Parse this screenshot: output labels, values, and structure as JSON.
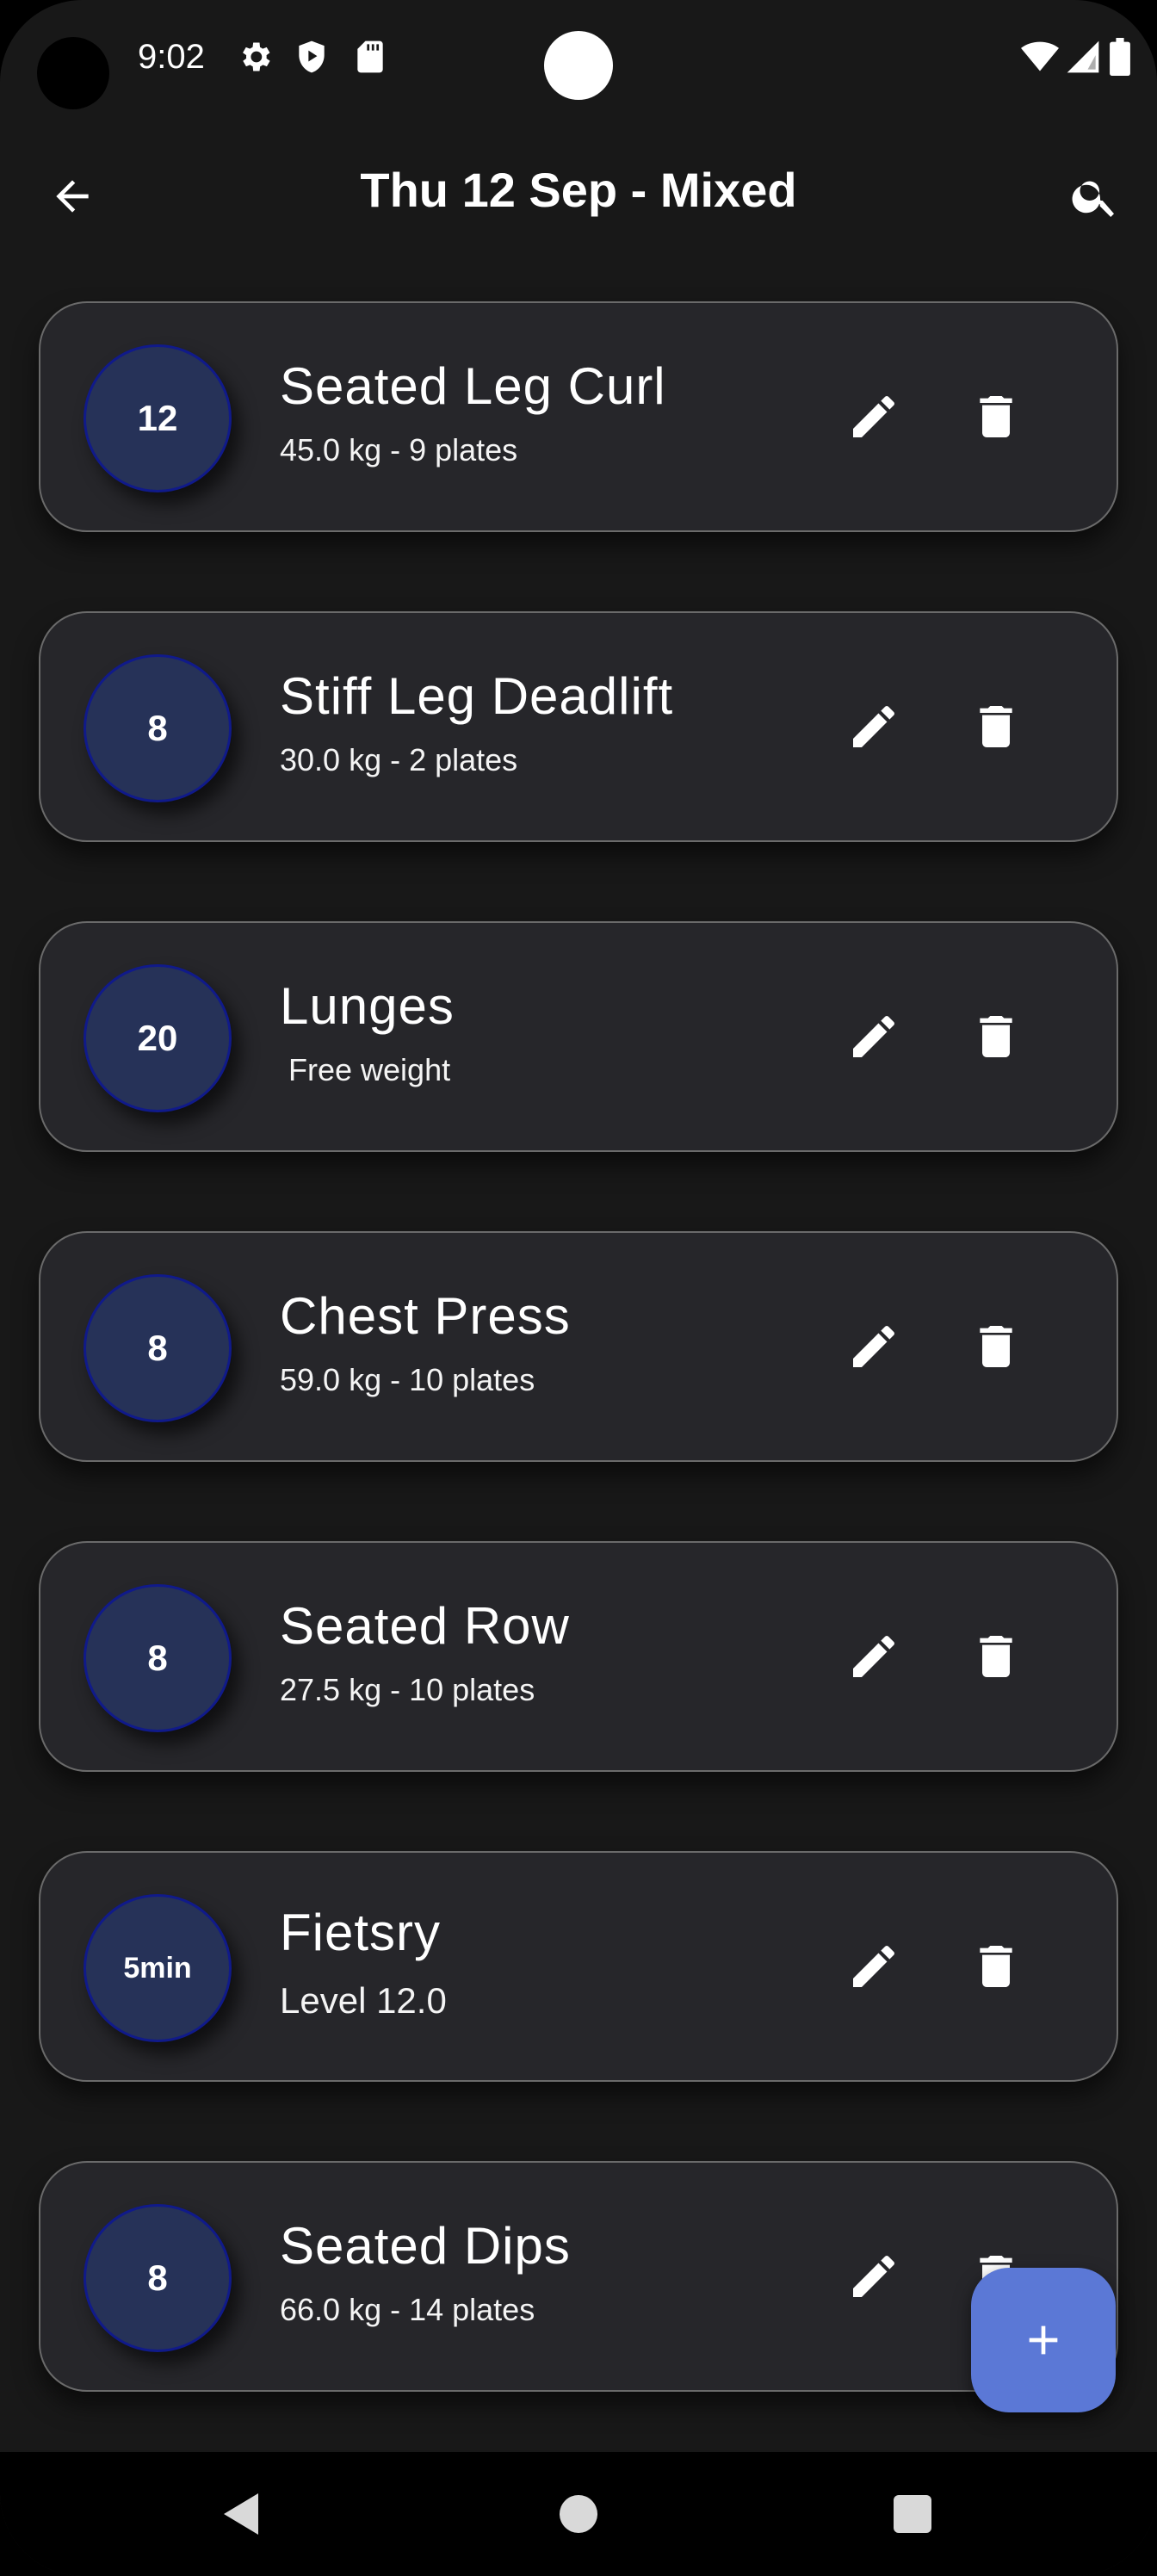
{
  "status_bar": {
    "time": "9:02",
    "left_icons": [
      "gear-icon",
      "shield-play-icon",
      "sd-card-icon"
    ],
    "right_icons": [
      "wifi-icon",
      "signal-icon",
      "battery-icon"
    ]
  },
  "app_bar": {
    "title": "Thu 12 Sep - Mixed",
    "back_icon": "arrow-left-icon",
    "search_icon": "search-icon"
  },
  "colors": {
    "background": "#181818",
    "card": "#26262a",
    "badge": "#263258",
    "badge_border": "#101a8a",
    "fab": "#5b78d6"
  },
  "exercises": [
    {
      "badge": "12",
      "name": "Seated Leg Curl",
      "detail": "45.0 kg - 9 plates"
    },
    {
      "badge": "8",
      "name": "Stiff Leg Deadlift",
      "detail": "30.0 kg - 2 plates"
    },
    {
      "badge": "20",
      "name": "Lunges",
      "detail": " Free weight"
    },
    {
      "badge": "8",
      "name": "Chest Press",
      "detail": "59.0 kg - 10 plates"
    },
    {
      "badge": "8",
      "name": "Seated Row",
      "detail": "27.5 kg - 10 plates"
    },
    {
      "badge": "5min",
      "name": "Fietsry",
      "detail": "Level 12.0"
    },
    {
      "badge": "8",
      "name": "Seated Dips",
      "detail": "66.0 kg - 14 plates"
    }
  ],
  "fab": {
    "icon": "plus-icon"
  },
  "nav_bar": {
    "icons": [
      "nav-back-icon",
      "nav-home-icon",
      "nav-recents-icon"
    ]
  }
}
